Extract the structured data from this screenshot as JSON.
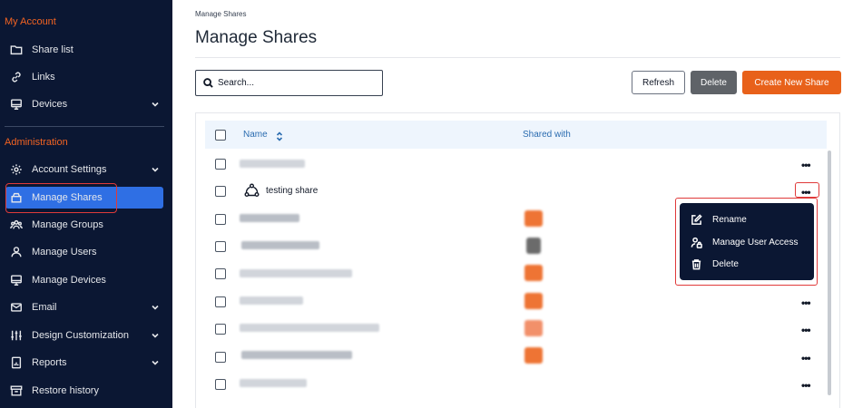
{
  "sidebar": {
    "my_account_title": "My Account",
    "share_list": "Share list",
    "links": "Links",
    "devices": "Devices",
    "administration_title": "Administration",
    "account_settings": "Account Settings",
    "manage_shares": "Manage Shares",
    "manage_groups": "Manage Groups",
    "manage_users": "Manage Users",
    "manage_devices": "Manage Devices",
    "email": "Email",
    "design_customization": "Design Customization",
    "reports": "Reports",
    "restore_history": "Restore history"
  },
  "header": {
    "breadcrumb": "Manage Shares",
    "title": "Manage Shares"
  },
  "toolbar": {
    "search_placeholder": "Search...",
    "refresh_label": "Refresh",
    "delete_label": "Delete",
    "create_label": "Create New Share"
  },
  "table": {
    "col_name": "Name",
    "col_shared_with": "Shared with",
    "visible_row_name": "testing share",
    "row_action_glyph": "•••"
  },
  "context_menu": {
    "rename": "Rename",
    "manage_user_access": "Manage User Access",
    "delete": "Delete"
  },
  "colors": {
    "sidebar_bg": "#0b1733",
    "accent_orange": "#e8611a",
    "active_blue": "#2f6fe4",
    "highlight_red": "#e03a3a"
  }
}
